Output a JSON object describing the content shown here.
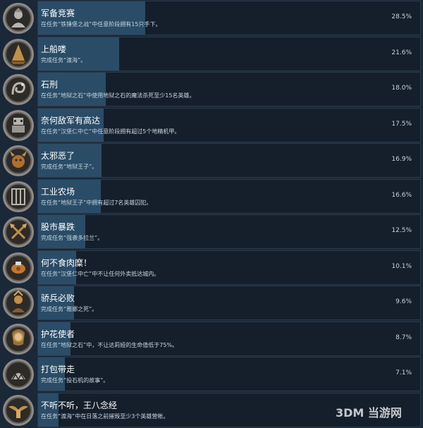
{
  "achievements": [
    {
      "title": "军备竞赛",
      "desc": "在任务“铁锤堡之战”中任意阶段拥有15只手下。",
      "percent_label": "28.5%",
      "percent": 28.5,
      "icon": "soldier-emblem-icon"
    },
    {
      "title": "上船喽",
      "desc": "完成任务“渡海”。",
      "percent_label": "21.6%",
      "percent": 21.6,
      "icon": "ship-sail-icon"
    },
    {
      "title": "石刑",
      "desc": "在任务“地狱之石”中使用地狱之石的魔法杀死至少15名英雄。",
      "percent_label": "18.0%",
      "percent": 18.0,
      "icon": "stone-serpent-icon"
    },
    {
      "title": "奈何敌军有高达",
      "desc": "在任务“汉堡仁中亡”中任意阶段拥有超过5个地精机甲。",
      "percent_label": "17.5%",
      "percent": 17.5,
      "icon": "mech-robot-icon"
    },
    {
      "title": "太邪恶了",
      "desc": "完成任务“地狱王子”。",
      "percent_label": "16.9%",
      "percent": 16.9,
      "icon": "demon-face-icon"
    },
    {
      "title": "工业农场",
      "desc": "在任务“地狱王子”中拥有超过7名英雄囚犯。",
      "percent_label": "16.6%",
      "percent": 16.6,
      "icon": "prison-cage-icon"
    },
    {
      "title": "股市暴跌",
      "desc": "完成任务“强袭多拉兰”。",
      "percent_label": "12.5%",
      "percent": 12.5,
      "icon": "crossed-axes-icon"
    },
    {
      "title": "何不食肉糜！",
      "desc": "在任务“汉堡仁中亡”中不让任何外卖抵达城内。",
      "percent_label": "10.1%",
      "percent": 10.1,
      "icon": "meat-food-icon"
    },
    {
      "title": "骄兵必败",
      "desc": "完成任务“雅娜之死”。",
      "percent_label": "9.6%",
      "percent": 9.6,
      "icon": "warrior-hero-icon"
    },
    {
      "title": "护花使者",
      "desc": "在任务“地狱之石”中，不让达莉娅的生命值低于75%。",
      "percent_label": "8.7%",
      "percent": 8.7,
      "icon": "elf-maiden-icon"
    },
    {
      "title": "打包带走",
      "desc": "完成任务“投石机的故事”。",
      "percent_label": "7.1%",
      "percent": 7.1,
      "icon": "catapult-beast-icon"
    },
    {
      "title": "不听不听，王八念经",
      "desc": "在任务“渡海”中在日落之前摧毁至少3个英雄营帐。",
      "percent_label": "",
      "percent": 5.5,
      "icon": "winged-idol-icon"
    }
  ],
  "watermark": {
    "text": "3DM 当游网"
  },
  "colors": {
    "background": "#1b2838",
    "panel": "#151f2b",
    "bar": "#2a4c67",
    "title_text": "#ffffff",
    "desc_text": "#c7d5e0",
    "icon_ring_outer": "#8d8a86",
    "icon_ring_inner": "#2d2b28",
    "icon_glyph": "#b8b4ae",
    "icon_glyph_gold": "#c09048"
  }
}
